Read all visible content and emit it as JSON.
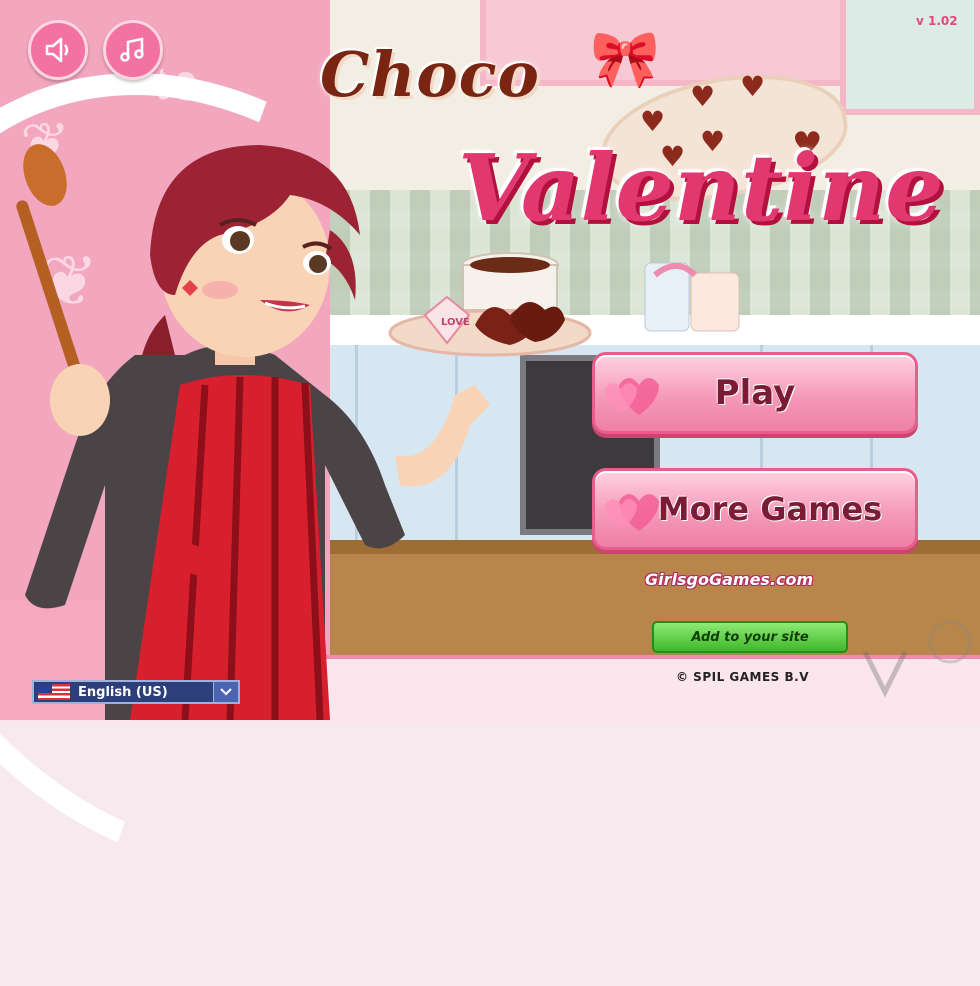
{
  "version": "v 1.02",
  "title": {
    "line1": "Choco",
    "line2": "Valentine"
  },
  "audio": {
    "sound_icon": "speaker-icon",
    "music_icon": "music-note-icon"
  },
  "menu": {
    "play_label": "Play",
    "more_games_label": "More Games"
  },
  "branding": {
    "site_logo": "GirlsgoGames.com",
    "add_to_site_label": "Add to your site",
    "copyright": "© SPIL GAMES B.V"
  },
  "language": {
    "selected": "English (US)",
    "flag_icon": "us-flag-icon",
    "dropdown_icon": "chevron-down-icon"
  },
  "plate_text": "LOVE",
  "colors": {
    "accent_pink": "#f273a2",
    "title_red": "#e23870",
    "chocolate": "#7a2412"
  }
}
